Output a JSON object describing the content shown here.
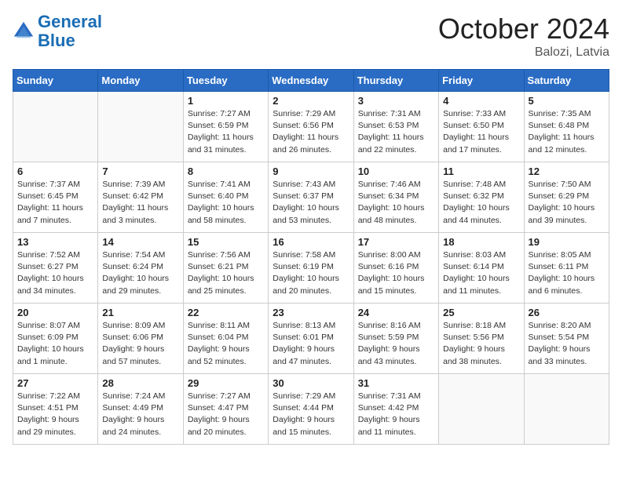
{
  "header": {
    "logo_line1": "General",
    "logo_line2": "Blue",
    "month": "October 2024",
    "location": "Balozi, Latvia"
  },
  "weekdays": [
    "Sunday",
    "Monday",
    "Tuesday",
    "Wednesday",
    "Thursday",
    "Friday",
    "Saturday"
  ],
  "weeks": [
    [
      {
        "day": "",
        "info": ""
      },
      {
        "day": "",
        "info": ""
      },
      {
        "day": "1",
        "info": "Sunrise: 7:27 AM\nSunset: 6:59 PM\nDaylight: 11 hours\nand 31 minutes."
      },
      {
        "day": "2",
        "info": "Sunrise: 7:29 AM\nSunset: 6:56 PM\nDaylight: 11 hours\nand 26 minutes."
      },
      {
        "day": "3",
        "info": "Sunrise: 7:31 AM\nSunset: 6:53 PM\nDaylight: 11 hours\nand 22 minutes."
      },
      {
        "day": "4",
        "info": "Sunrise: 7:33 AM\nSunset: 6:50 PM\nDaylight: 11 hours\nand 17 minutes."
      },
      {
        "day": "5",
        "info": "Sunrise: 7:35 AM\nSunset: 6:48 PM\nDaylight: 11 hours\nand 12 minutes."
      }
    ],
    [
      {
        "day": "6",
        "info": "Sunrise: 7:37 AM\nSunset: 6:45 PM\nDaylight: 11 hours\nand 7 minutes."
      },
      {
        "day": "7",
        "info": "Sunrise: 7:39 AM\nSunset: 6:42 PM\nDaylight: 11 hours\nand 3 minutes."
      },
      {
        "day": "8",
        "info": "Sunrise: 7:41 AM\nSunset: 6:40 PM\nDaylight: 10 hours\nand 58 minutes."
      },
      {
        "day": "9",
        "info": "Sunrise: 7:43 AM\nSunset: 6:37 PM\nDaylight: 10 hours\nand 53 minutes."
      },
      {
        "day": "10",
        "info": "Sunrise: 7:46 AM\nSunset: 6:34 PM\nDaylight: 10 hours\nand 48 minutes."
      },
      {
        "day": "11",
        "info": "Sunrise: 7:48 AM\nSunset: 6:32 PM\nDaylight: 10 hours\nand 44 minutes."
      },
      {
        "day": "12",
        "info": "Sunrise: 7:50 AM\nSunset: 6:29 PM\nDaylight: 10 hours\nand 39 minutes."
      }
    ],
    [
      {
        "day": "13",
        "info": "Sunrise: 7:52 AM\nSunset: 6:27 PM\nDaylight: 10 hours\nand 34 minutes."
      },
      {
        "day": "14",
        "info": "Sunrise: 7:54 AM\nSunset: 6:24 PM\nDaylight: 10 hours\nand 29 minutes."
      },
      {
        "day": "15",
        "info": "Sunrise: 7:56 AM\nSunset: 6:21 PM\nDaylight: 10 hours\nand 25 minutes."
      },
      {
        "day": "16",
        "info": "Sunrise: 7:58 AM\nSunset: 6:19 PM\nDaylight: 10 hours\nand 20 minutes."
      },
      {
        "day": "17",
        "info": "Sunrise: 8:00 AM\nSunset: 6:16 PM\nDaylight: 10 hours\nand 15 minutes."
      },
      {
        "day": "18",
        "info": "Sunrise: 8:03 AM\nSunset: 6:14 PM\nDaylight: 10 hours\nand 11 minutes."
      },
      {
        "day": "19",
        "info": "Sunrise: 8:05 AM\nSunset: 6:11 PM\nDaylight: 10 hours\nand 6 minutes."
      }
    ],
    [
      {
        "day": "20",
        "info": "Sunrise: 8:07 AM\nSunset: 6:09 PM\nDaylight: 10 hours\nand 1 minute."
      },
      {
        "day": "21",
        "info": "Sunrise: 8:09 AM\nSunset: 6:06 PM\nDaylight: 9 hours\nand 57 minutes."
      },
      {
        "day": "22",
        "info": "Sunrise: 8:11 AM\nSunset: 6:04 PM\nDaylight: 9 hours\nand 52 minutes."
      },
      {
        "day": "23",
        "info": "Sunrise: 8:13 AM\nSunset: 6:01 PM\nDaylight: 9 hours\nand 47 minutes."
      },
      {
        "day": "24",
        "info": "Sunrise: 8:16 AM\nSunset: 5:59 PM\nDaylight: 9 hours\nand 43 minutes."
      },
      {
        "day": "25",
        "info": "Sunrise: 8:18 AM\nSunset: 5:56 PM\nDaylight: 9 hours\nand 38 minutes."
      },
      {
        "day": "26",
        "info": "Sunrise: 8:20 AM\nSunset: 5:54 PM\nDaylight: 9 hours\nand 33 minutes."
      }
    ],
    [
      {
        "day": "27",
        "info": "Sunrise: 7:22 AM\nSunset: 4:51 PM\nDaylight: 9 hours\nand 29 minutes."
      },
      {
        "day": "28",
        "info": "Sunrise: 7:24 AM\nSunset: 4:49 PM\nDaylight: 9 hours\nand 24 minutes."
      },
      {
        "day": "29",
        "info": "Sunrise: 7:27 AM\nSunset: 4:47 PM\nDaylight: 9 hours\nand 20 minutes."
      },
      {
        "day": "30",
        "info": "Sunrise: 7:29 AM\nSunset: 4:44 PM\nDaylight: 9 hours\nand 15 minutes."
      },
      {
        "day": "31",
        "info": "Sunrise: 7:31 AM\nSunset: 4:42 PM\nDaylight: 9 hours\nand 11 minutes."
      },
      {
        "day": "",
        "info": ""
      },
      {
        "day": "",
        "info": ""
      }
    ]
  ]
}
